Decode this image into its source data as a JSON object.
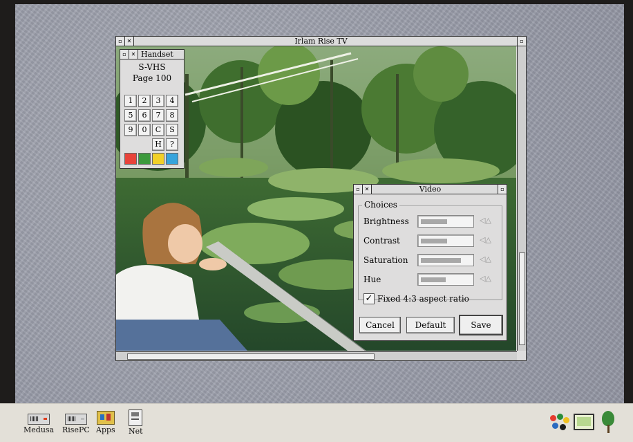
{
  "tv_window": {
    "title": "Irlam Rise TV"
  },
  "handset": {
    "title": "Handset",
    "source": "S-VHS",
    "page": "Page 100",
    "keys": [
      "1",
      "2",
      "3",
      "4",
      "5",
      "6",
      "7",
      "8",
      "9",
      "0",
      "C",
      "S",
      "H",
      "?"
    ],
    "colour_keys": [
      "#e8433a",
      "#3c9a3c",
      "#f2d028",
      "#36a4dc"
    ]
  },
  "video": {
    "title": "Video",
    "group_label": "Choices",
    "controls": [
      {
        "label": "Brightness",
        "level": 0.55
      },
      {
        "label": "Contrast",
        "level": 0.55
      },
      {
        "label": "Saturation",
        "level": 0.8
      },
      {
        "label": "Hue",
        "level": 0.5
      }
    ],
    "aspect_checkbox": {
      "label": "Fixed 4:3 aspect ratio",
      "checked": true,
      "mark": "✓"
    },
    "buttons": {
      "cancel": "Cancel",
      "default": "Default",
      "save": "Save"
    }
  },
  "iconbar": {
    "left_items": [
      {
        "label": "Medusa",
        "icon": "harddisc-icon"
      },
      {
        "label": "RisePC",
        "icon": "harddisc-icon"
      },
      {
        "label": "Apps",
        "icon": "apps-icon"
      },
      {
        "label": "Net",
        "icon": "network-icon"
      }
    ],
    "right_icons": [
      "palette-icon",
      "display-icon",
      "tv-app-icon"
    ]
  }
}
